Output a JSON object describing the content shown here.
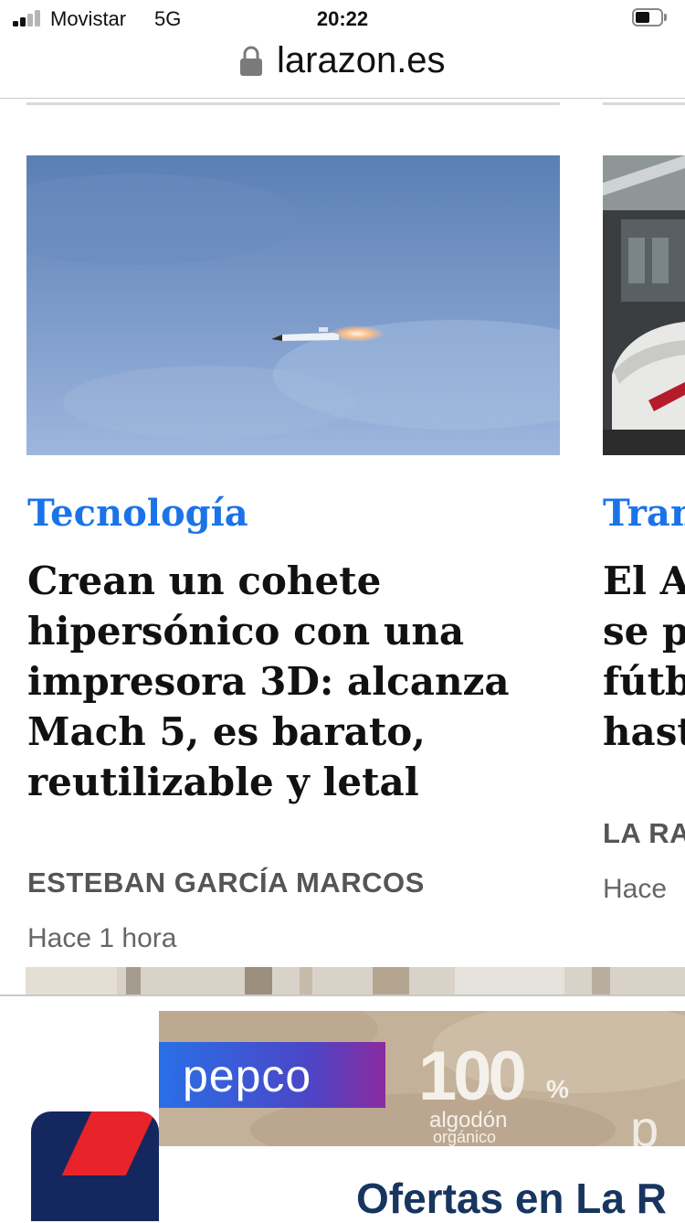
{
  "status_bar": {
    "carrier": "Movistar",
    "network": "5G",
    "time": "20:22",
    "signal_bars_active": 2,
    "signal_bars_total": 4
  },
  "browser": {
    "url": "larazon.es",
    "lock_icon": "lock-icon"
  },
  "articles": [
    {
      "category": "Tecnología",
      "headline_lines": [
        "Crean un cohete",
        "hipersónico con una",
        "impresora 3D: alcanza",
        "Mach 5, es barato,",
        "reutilizable y letal"
      ],
      "author": "ESTEBAN GARCÍA MARCOS",
      "time": "Hace 1 hora",
      "image": "rocket-in-sky"
    },
    {
      "category": "Tran",
      "headline_lines": [
        "El A",
        "se p",
        "fútb",
        "hast"
      ],
      "author": "LA RA",
      "time": "Hace",
      "image": "high-speed-train"
    }
  ],
  "ad": {
    "brand": "pepco",
    "promo_value": "100",
    "promo_unit": "%",
    "promo_sub": "algodón",
    "promo_sub2": "orgánico",
    "promo_tail": "p",
    "offer_text": "Ofertas en La R"
  },
  "colors": {
    "category": "#1a73e8",
    "headline": "#111111",
    "author": "#555555",
    "pepco_blue": "#2a6fe6",
    "offer_navy": "#17355f",
    "logo_navy": "#14275e",
    "logo_red": "#e8232a"
  }
}
